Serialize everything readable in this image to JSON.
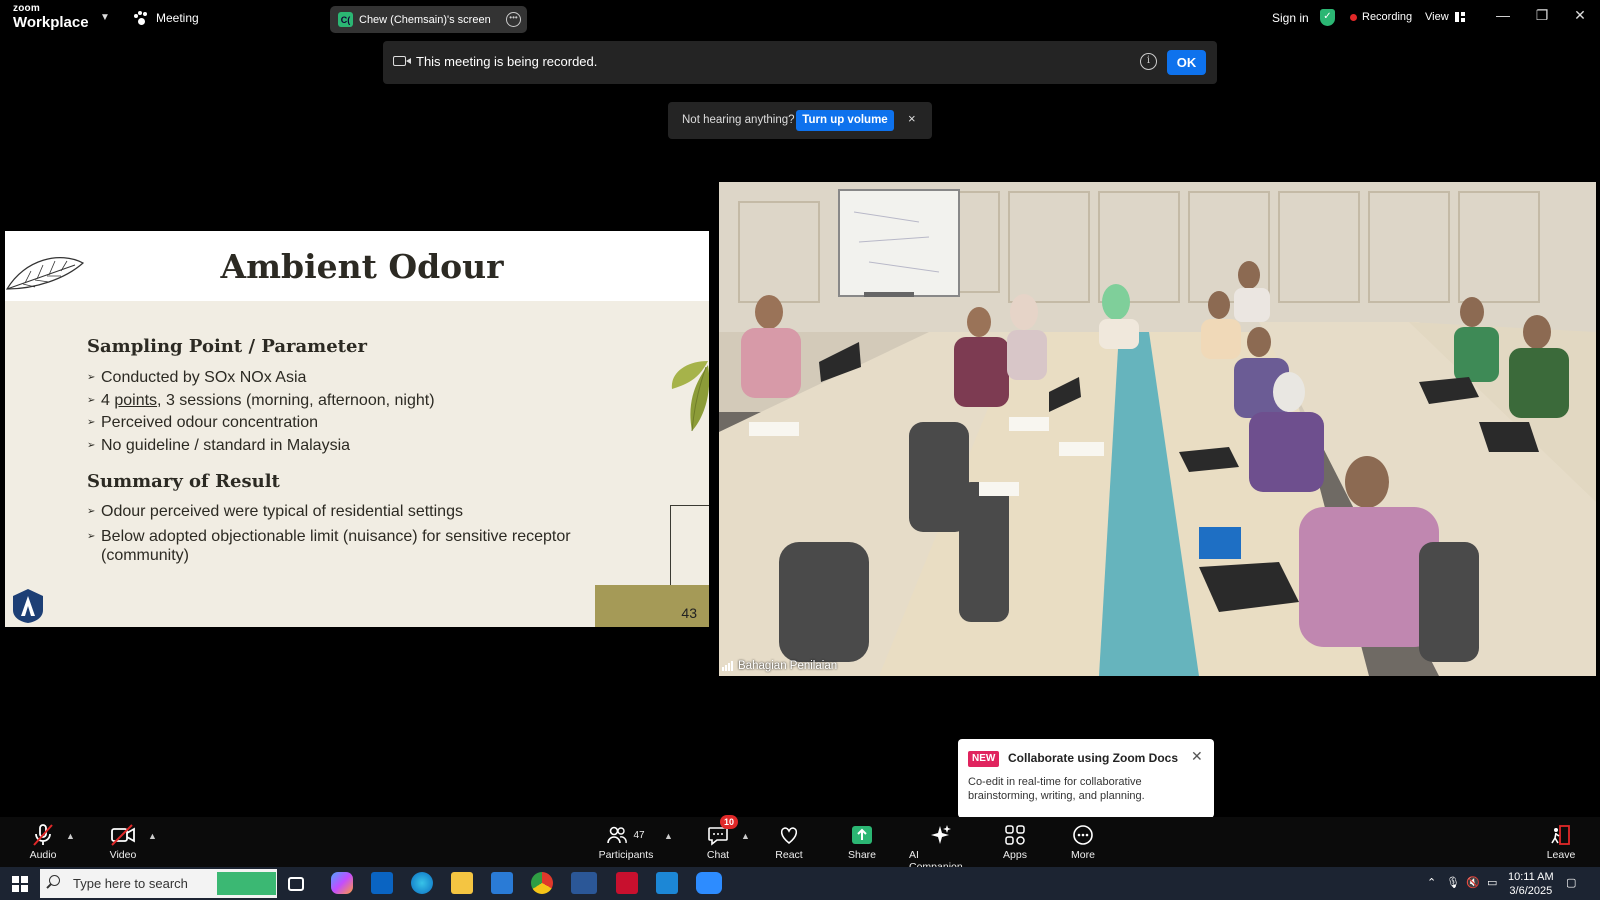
{
  "app": {
    "logo_line1": "zoom",
    "logo_line2": "Workplace",
    "meeting_label": "Meeting",
    "screen_share_avatar": "C(",
    "screen_share_label": "Chew (Chemsain)'s screen",
    "sign_in": "Sign in",
    "recording_label": "Recording",
    "view_label": "View"
  },
  "recording_banner": {
    "text": "This meeting is being recorded.",
    "info_glyph": "i",
    "ok_label": "OK"
  },
  "volume_banner": {
    "text": "Not hearing anything?",
    "button_label": "Turn up volume",
    "close_glyph": "×"
  },
  "slide": {
    "title": "Ambient Odour",
    "section1_title": "Sampling Point / Parameter",
    "bullets1": [
      "Conducted by SOx NOx Asia",
      "Perceived odour concentration",
      "No guideline / standard in Malaysia"
    ],
    "bullet_points_prefix": "4 ",
    "bullet_points_underlined": "points",
    "bullet_points_suffix": ", 3 sessions (morning, afternoon, night)",
    "section2_title": "Summary of Result",
    "bullets2": [
      "Odour perceived were typical of residential settings",
      "Below adopted objectionable limit (nuisance) for sensitive receptor (community)"
    ],
    "page_number": "43",
    "colors": {
      "background": "#f1ede3",
      "footer_band": "#a59a57",
      "leaf_green": "#8c9c38"
    }
  },
  "video": {
    "participant_name": "Bahagian Penilaian"
  },
  "popup": {
    "badge": "NEW",
    "title": "Collaborate using Zoom Docs",
    "description": "Co-edit in real-time for collaborative brainstorming, writing, and planning.",
    "close_glyph": "✕"
  },
  "toolbar": {
    "audio": "Audio",
    "video": "Video",
    "participants": "Participants",
    "participants_count": "47",
    "chat": "Chat",
    "chat_badge": "10",
    "react": "React",
    "share": "Share",
    "ai_companion": "AI Companion",
    "apps": "Apps",
    "more": "More",
    "leave": "Leave",
    "colors": {
      "accent_blue": "#0e72ed",
      "share_green": "#2bb673",
      "muted_red": "#e02828"
    }
  },
  "taskbar": {
    "search_placeholder": "Type here to search",
    "time": "10:11 AM",
    "date": "3/6/2025",
    "icons": [
      "task-view-icon",
      "copilot-icon",
      "outlook-icon",
      "edge-icon",
      "file-explorer-icon",
      "store-icon",
      "chrome-icon",
      "word-icon",
      "acrobat-icon",
      "snipping-tool-icon",
      "zoom-icon"
    ]
  }
}
